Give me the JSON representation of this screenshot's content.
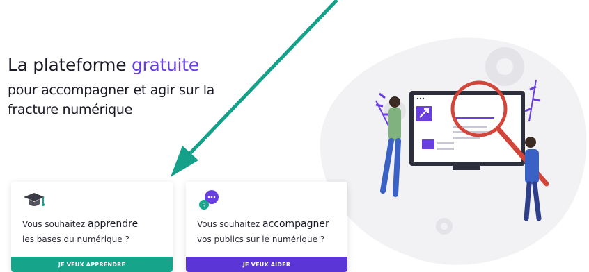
{
  "hero": {
    "headline_prefix": "La plateforme ",
    "headline_accent": "gratuite",
    "subline": "pour accompagner et agir sur la fracture numérique"
  },
  "cards": {
    "learn": {
      "line1_prefix": "Vous souhaitez ",
      "line1_strong": "apprendre",
      "line2": "les bases du numérique ?",
      "button": "JE VEUX APPRENDRE",
      "icon": "graduation-cap-icon"
    },
    "help": {
      "line1_prefix": "Vous souhaitez ",
      "line1_strong": "accompagner",
      "line2": "vos publics sur le numérique ?",
      "button": "JE VEUX AIDER",
      "icon": "chat-bubbles-icon"
    }
  },
  "colors": {
    "accent": "#6a3fe0",
    "green": "#16a58b",
    "purple": "#5b35d5",
    "arrow": "#15a08a"
  }
}
